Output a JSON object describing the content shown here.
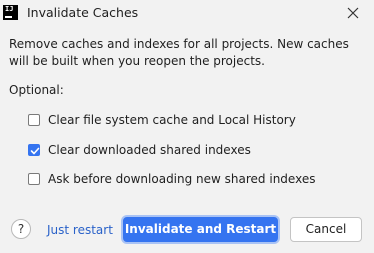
{
  "dialog": {
    "title": "Invalidate Caches",
    "app_icon_text": "IJ",
    "description": "Remove caches and indexes for all projects. New caches will be built when you reopen the projects.",
    "optional_label": "Optional:",
    "options": [
      {
        "label": "Clear file system cache and Local History",
        "checked": false
      },
      {
        "label": "Clear downloaded shared indexes",
        "checked": true
      },
      {
        "label": "Ask before downloading new shared indexes",
        "checked": false
      }
    ],
    "help_label": "?",
    "just_restart_label": "Just restart",
    "primary_button_label": "Invalidate and Restart",
    "cancel_button_label": "Cancel"
  },
  "colors": {
    "accent": "#3574f0",
    "link": "#2a62c9",
    "background": "#f2f2f2"
  },
  "icons": [
    "intellij-app-icon",
    "close-icon",
    "checkmark-icon",
    "help-icon"
  ]
}
